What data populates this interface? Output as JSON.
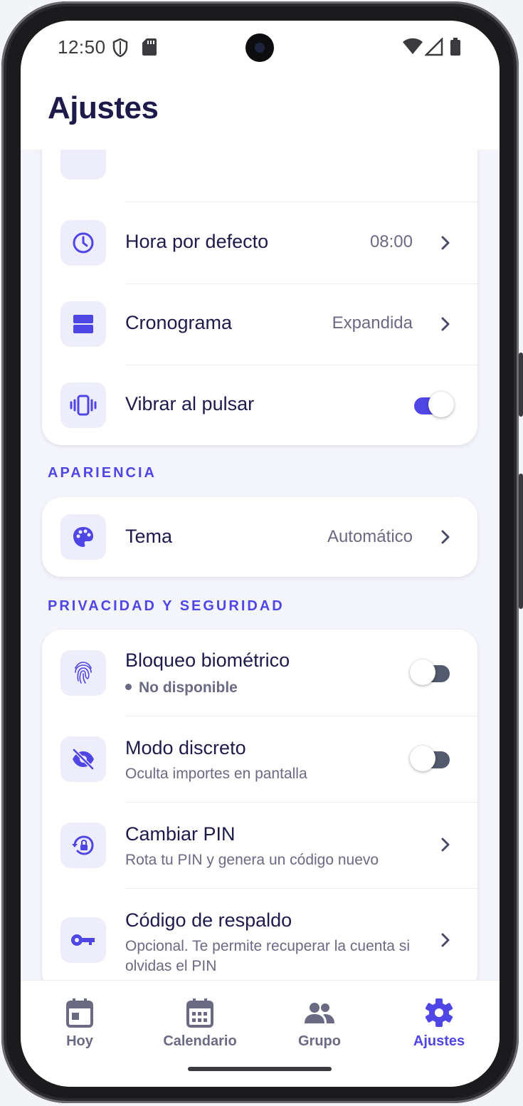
{
  "status_bar": {
    "time": "12:50"
  },
  "header": {
    "title": "Ajustes"
  },
  "colors": {
    "accent": "#4f46e5",
    "title": "#1e1b4b",
    "muted": "#6b6a83",
    "icon_bg": "#eeedfb"
  },
  "general_card": {
    "rows": [
      {
        "label": "Hora por defecto",
        "value": "08:00",
        "icon": "clock-icon"
      },
      {
        "label": "Cronograma",
        "value": "Expandida",
        "icon": "timeline-icon"
      },
      {
        "label": "Vibrar al pulsar",
        "icon": "vibrate-icon",
        "toggle": true
      }
    ]
  },
  "appearance": {
    "section_title": "APARIENCIA",
    "rows": [
      {
        "label": "Tema",
        "value": "Automático",
        "icon": "palette-icon"
      }
    ]
  },
  "privacy": {
    "section_title": "PRIVACIDAD Y SEGURIDAD",
    "rows": [
      {
        "label": "Bloqueo biométrico",
        "sub": "No disponible",
        "icon": "fingerprint-icon",
        "toggle": false
      },
      {
        "label": "Modo discreto",
        "sub": "Oculta importes en pantalla",
        "icon": "eye-off-icon",
        "toggle": false
      },
      {
        "label": "Cambiar PIN",
        "sub": "Rota tu PIN y genera un código nuevo",
        "icon": "lock-reset-icon"
      },
      {
        "label": "Código de respaldo",
        "sub": "Opcional. Te permite recuperar la cuenta si olvidas el PIN",
        "icon": "key-icon"
      }
    ]
  },
  "bottom_nav": {
    "items": [
      {
        "label": "Hoy",
        "icon": "calendar-today-icon",
        "active": false
      },
      {
        "label": "Calendario",
        "icon": "calendar-month-icon",
        "active": false
      },
      {
        "label": "Grupo",
        "icon": "group-icon",
        "active": false
      },
      {
        "label": "Ajustes",
        "icon": "gear-icon",
        "active": true
      }
    ]
  }
}
